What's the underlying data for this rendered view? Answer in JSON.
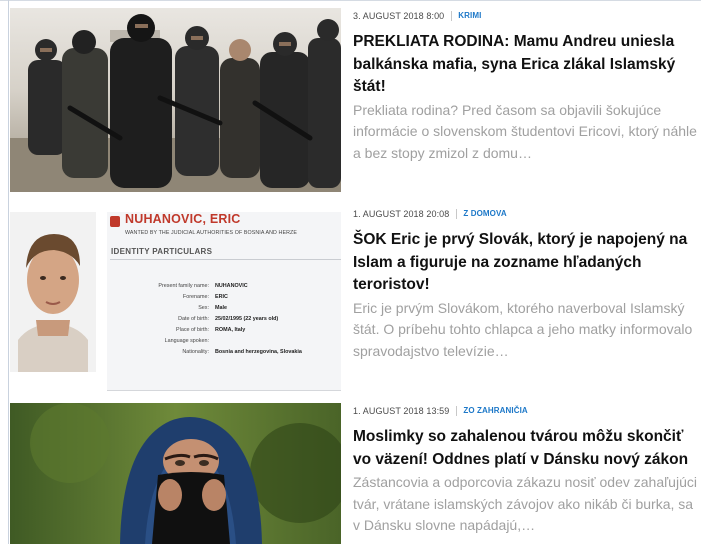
{
  "articles": [
    {
      "date": "3. AUGUST 2018 8:00",
      "category": "KRIMI",
      "headline": "PREKLIATA RODINA: Mamu Andreu uniesla balkánska mafia, syna Erica zlákal Islamský štát!",
      "perex": "Prekliata rodina? Pred časom sa objavili šokujúce informácie o slovenskom študentovi Ericovi, ktorý náhle a bez stopy zmizol z domu…",
      "image": "group-of-armed-masked-fighters"
    },
    {
      "date": "1. AUGUST 2018 20:08",
      "category": "Z DOMOVA",
      "headline": "ŠOK Eric je prvý Slovák, ktorý je napojený na Islam a figuruje na zozname hľadaných teroristov!",
      "perex": "Eric je prvým Slovákom, ktorého naverboval Islamský štát. O príbehu tohto chlapca a jeho matky informovalo spravodajstvo televízie…",
      "image": "interpol-wanted-notice",
      "notice": {
        "name": "NUHANOVIC, ERIC",
        "wanted": "WANTED BY THE JUDICIAL AUTHORITIES OF BOSNIA AND HERZE",
        "section": "IDENTITY PARTICULARS",
        "rows": [
          {
            "k": "Present family name:",
            "v": "NUHANOVIC"
          },
          {
            "k": "Forename:",
            "v": "ERIC"
          },
          {
            "k": "Sex:",
            "v": "Male"
          },
          {
            "k": "Date of birth:",
            "v": "25/02/1995 (22 years old)"
          },
          {
            "k": "Place of birth:",
            "v": "ROMA, Italy"
          },
          {
            "k": "Language spoken:",
            "v": ""
          },
          {
            "k": "Nationality:",
            "v": "Bosnia and herzegovina, Slovakia"
          }
        ]
      }
    },
    {
      "date": "1. AUGUST 2018 13:59",
      "category": "ZO ZAHRANIČIA",
      "headline": "Moslimky so zahalenou tvárou môžu skončiť vo väzení! Oddnes platí v Dánsku nový zákon",
      "perex": "Zástancovia a odporcovia zákazu nosiť odev zahaľujúci tvár, vrátane islamských závojov ako nikáb či burka, sa v Dánsku slovne napádajú,…",
      "image": "woman-in-blue-hijab-covering-face"
    }
  ],
  "colors": {
    "category": "#1d78c8",
    "headline": "#111111",
    "perex": "#a0a0a0",
    "notice_red": "#c0392b"
  }
}
